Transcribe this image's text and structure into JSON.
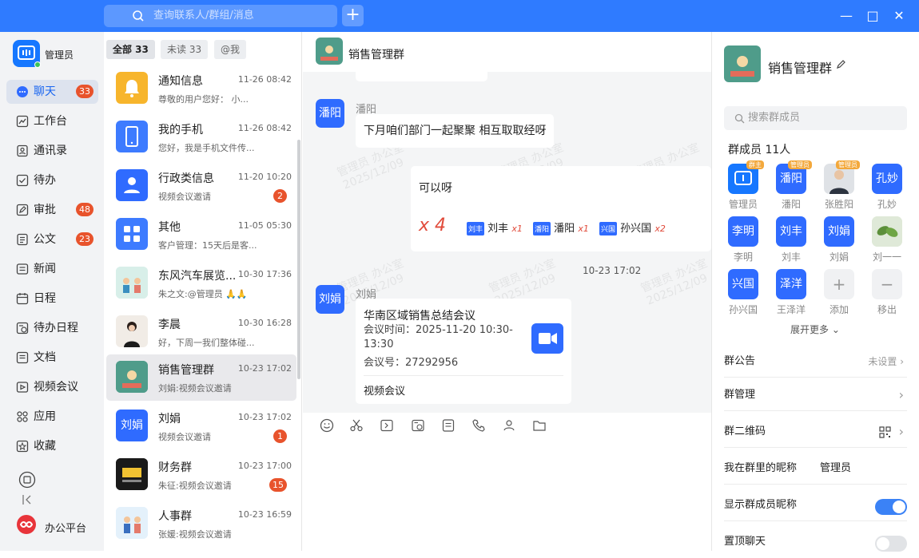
{
  "topbar": {
    "search_placeholder": "查询联系人/群组/消息",
    "add": "+",
    "min": "—",
    "max": "□",
    "close": "✕"
  },
  "user": {
    "name": "管理员"
  },
  "nav": [
    {
      "label": "聊天",
      "badge": "33"
    },
    {
      "label": "工作台"
    },
    {
      "label": "通讯录"
    },
    {
      "label": "待办"
    },
    {
      "label": "审批",
      "badge": "48"
    },
    {
      "label": "公文",
      "badge": "23"
    },
    {
      "label": "新闻"
    },
    {
      "label": "日程"
    },
    {
      "label": "待办日程"
    },
    {
      "label": "文档"
    },
    {
      "label": "视频会议"
    },
    {
      "label": "应用"
    },
    {
      "label": "收藏"
    }
  ],
  "platform": "办公平台",
  "filters": [
    "全部 33",
    "未读 33",
    "@我"
  ],
  "conversations": [
    {
      "name": "通知信息",
      "time": "11-26 08:42",
      "preview": "尊敬的用户您好：  小...",
      "color": "#f7b52c"
    },
    {
      "name": "我的手机",
      "time": "11-26 08:42",
      "preview": "您好，我是手机文件传...",
      "color": "#3d7bff"
    },
    {
      "name": "行政类信息",
      "time": "11-20 10:20",
      "preview": "视频会议邀请",
      "badge": "2",
      "color": "#2f6bff"
    },
    {
      "name": "其他",
      "time": "11-05 05:30",
      "preview": "客户管理：15天后是客...",
      "color": "#3d7bff"
    },
    {
      "name": "东风汽车展览...",
      "time": "10-30 17:36",
      "preview": "朱之文:@管理员 🙏🙏",
      "color": "#cfe8e6"
    },
    {
      "name": "李晨",
      "time": "10-30 16:28",
      "preview": "好，下周一我们整体碰...",
      "color": "#e9e2dc"
    },
    {
      "name": "销售管理群",
      "time": "10-23 17:02",
      "preview": "刘娟:视频会议邀请",
      "color": "#5fa896"
    },
    {
      "name": "刘娟",
      "time": "10-23 17:02",
      "preview": "视频会议邀请",
      "badge": "1",
      "color": "#2f6bff"
    },
    {
      "name": "财务群",
      "time": "10-23 17:00",
      "preview": "朱征:视频会议邀请",
      "badge": "15",
      "color": "#1f1f1f"
    },
    {
      "name": "人事群",
      "time": "10-23 16:59",
      "preview": "张媛:视频会议邀请",
      "color": "#ddeefa"
    }
  ],
  "chat": {
    "title": "销售管理群",
    "watermark": [
      "管理员 办公室",
      "2025/12/09"
    ],
    "msg1": {
      "avatar": "潘阳",
      "sender": "潘阳",
      "text": "下月咱们部门一起聚聚 相互取取经呀"
    },
    "msg2": {
      "text": "可以呀",
      "multiplier": "x 4",
      "reacts": [
        {
          "tag": "刘丰",
          "name": "刘丰",
          "count": "x1"
        },
        {
          "tag": "潘阳",
          "name": "潘阳",
          "count": "x1"
        },
        {
          "tag": "兴国",
          "name": "孙兴国",
          "count": "x2"
        }
      ]
    },
    "timestamp": "10-23 17:02",
    "msg3": {
      "avatar": "刘娟",
      "sender": "刘娟",
      "title": "华南区域销售总结会议",
      "time_label": "会议时间：",
      "time": "2025-11-20 10:30-13:30",
      "no_label": "会议号：",
      "no": "27292956",
      "foot": "视频会议"
    }
  },
  "panel": {
    "title": "销售管理群",
    "search_placeholder": "搜索群成员",
    "member_count": "群成员 11人",
    "members": [
      {
        "avatar": "",
        "label": "管理员",
        "tag": "群主"
      },
      {
        "avatar": "潘阳",
        "label": "潘阳",
        "tag": "管理员"
      },
      {
        "avatar": "",
        "label": "张胜阳",
        "tag": "管理员"
      },
      {
        "avatar": "孔妙",
        "label": "孔妙"
      },
      {
        "avatar": "李明",
        "label": "李明"
      },
      {
        "avatar": "刘丰",
        "label": "刘丰"
      },
      {
        "avatar": "刘娟",
        "label": "刘娟"
      },
      {
        "avatar": "",
        "label": "刘一一"
      },
      {
        "avatar": "兴国",
        "label": "孙兴国"
      },
      {
        "avatar": "泽洋",
        "label": "王泽洋"
      },
      {
        "avatar": "+",
        "label": "添加"
      },
      {
        "avatar": "−",
        "label": "移出"
      }
    ],
    "expand": "展开更多",
    "notice": "群公告",
    "notice_value": "未设置",
    "manage": "群管理",
    "qrcode": "群二维码",
    "nickname": "我在群里的昵称",
    "nickname_value": "管理员",
    "show_nick": "显示群成员昵称",
    "pin": "置顶聊天",
    "colors": {
      "accent": "#2f7bff",
      "toggle_on": "#3b82f6",
      "toggle_off": "#e1e3e6"
    }
  }
}
